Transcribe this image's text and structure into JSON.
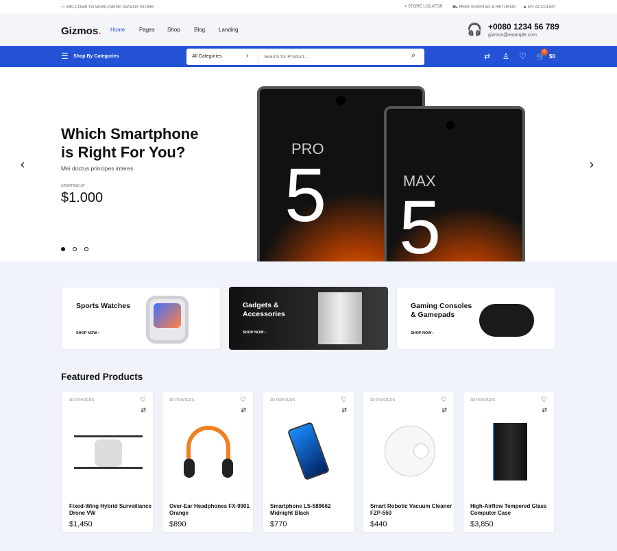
{
  "topbar": {
    "welcome": "Welcome to Worldwide Gizmos Store",
    "store_locator": "Store Locator",
    "shipping": "Free Shipping & Returns",
    "account": "My Account"
  },
  "header": {
    "logo": "Gizmos",
    "logo_dot": ".",
    "nav": [
      "Home",
      "Pages",
      "Shop",
      "Blog",
      "Landing"
    ],
    "phone": "+0080 1234 56 789",
    "email": "gizmos@example.com"
  },
  "bluebar": {
    "categories_label": "Shop By Categories",
    "category_select": "All Categories",
    "search_placeholder": "Search for Product...",
    "cart_count": "0",
    "cart_total": "$0"
  },
  "hero": {
    "title_line1": "Which Smartphone",
    "title_line2": "is Right For You?",
    "subtitle": "Mei doctus principes interes",
    "starting_label": "STARTING AT",
    "price": "$1.000",
    "phone1_label": "PRO",
    "phone1_number": "5",
    "phone2_label": "MAX",
    "phone2_number": "5",
    "slides": 3,
    "active_slide": 1
  },
  "categories": [
    {
      "title_line1": "Sports Watches",
      "title_line2": "",
      "cta": "SHOP NOW"
    },
    {
      "title_line1": "Gadgets &",
      "title_line2": "Accessories",
      "cta": "SHOP NOW"
    },
    {
      "title_line1": "Gaming Consoles",
      "title_line2": "& Gamepads",
      "cta": "SHOP NOW"
    }
  ],
  "featured": {
    "title": "Featured Products",
    "products": [
      {
        "category": "3D PRINTERS",
        "name": "Fixed-Wing Hybrid Surveillance Drone VW",
        "price": "$1,450"
      },
      {
        "category": "3D PRINTERS",
        "name": "Over-Ear Headphones FX-9901 Orange",
        "price": "$890"
      },
      {
        "category": "3D PRINTERS",
        "name": "Smartphone LS-589662 Midnight Black",
        "price": "$770"
      },
      {
        "category": "3D PRINTERS",
        "name": "Smart Robotic Vacuum Cleaner FZP-550",
        "price": "$440"
      },
      {
        "category": "3D PRINTERS",
        "name": "High-Airflow Tempered Glass Computer Case",
        "price": "$3,850"
      }
    ]
  },
  "colors": {
    "brand_blue": "#2352d6",
    "accent_orange": "#f05a1a"
  }
}
